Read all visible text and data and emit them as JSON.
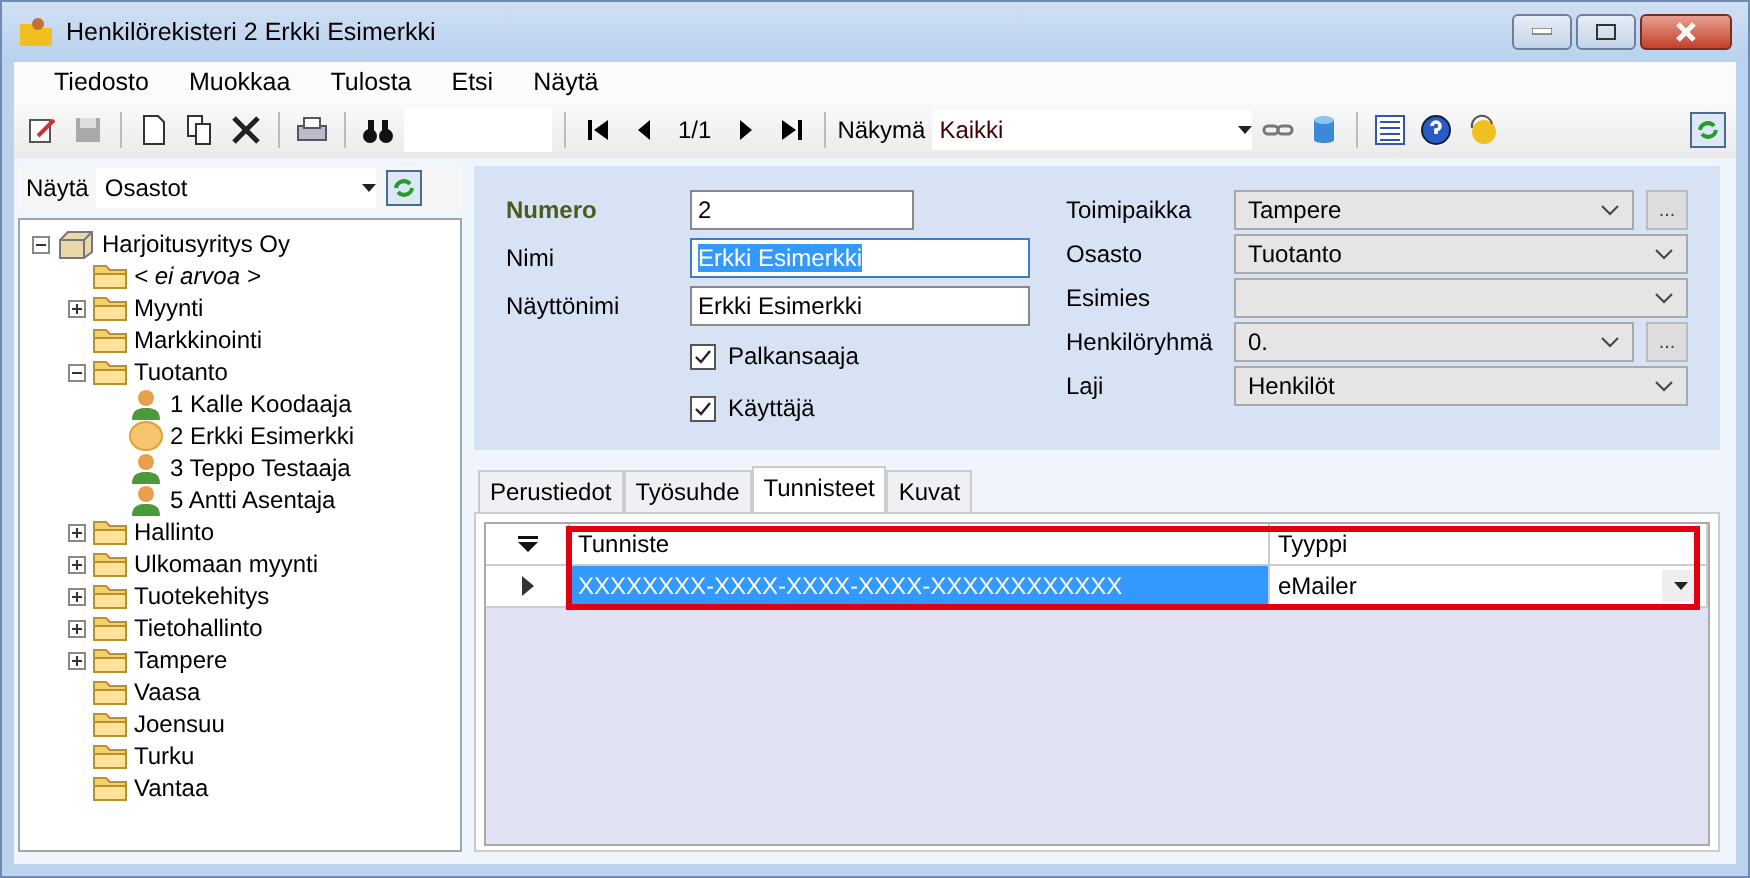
{
  "window": {
    "title": "Henkilörekisteri 2 Erkki Esimerkki"
  },
  "menu": [
    "Tiedosto",
    "Muokkaa",
    "Tulosta",
    "Etsi",
    "Näytä"
  ],
  "toolbar": {
    "position": "1/1",
    "view_label": "Näkymä",
    "view_value": "Kaikki"
  },
  "sidebar": {
    "filter_label": "Näytä",
    "filter_value": "Osastot",
    "tree": [
      {
        "label": "Harjoitusyritys Oy",
        "kind": "company",
        "expanded": true,
        "children": [
          {
            "label": "< ei arvoa >",
            "kind": "empty"
          },
          {
            "label": "Myynti",
            "kind": "folder",
            "expanded": false
          },
          {
            "label": "Markkinointi",
            "kind": "folder"
          },
          {
            "label": "Tuotanto",
            "kind": "folder",
            "expanded": true,
            "children": [
              {
                "label": "1 Kalle Koodaaja",
                "kind": "person"
              },
              {
                "label": "2 Erkki Esimerkki",
                "kind": "current-person"
              },
              {
                "label": "3 Teppo Testaaja",
                "kind": "person"
              },
              {
                "label": "5 Antti Asentaja",
                "kind": "person"
              }
            ]
          },
          {
            "label": "Hallinto",
            "kind": "folder",
            "expanded": false
          },
          {
            "label": "Ulkomaan myynti",
            "kind": "folder",
            "expanded": false
          },
          {
            "label": "Tuotekehitys",
            "kind": "folder",
            "expanded": false
          },
          {
            "label": "Tietohallinto",
            "kind": "folder",
            "expanded": false
          },
          {
            "label": "Tampere",
            "kind": "folder",
            "expanded": false
          },
          {
            "label": "Vaasa",
            "kind": "folder"
          },
          {
            "label": "Joensuu",
            "kind": "folder"
          },
          {
            "label": "Turku",
            "kind": "folder"
          },
          {
            "label": "Vantaa",
            "kind": "folder"
          }
        ]
      }
    ]
  },
  "form": {
    "fields": [
      {
        "label": "Numero",
        "value": "2",
        "bold": true,
        "selected": false,
        "wide": false
      },
      {
        "label": "Nimi",
        "value": "Erkki Esimerkki",
        "bold": false,
        "selected": true,
        "wide": true
      },
      {
        "label": "Näyttönimi",
        "value": "Erkki Esimerkki",
        "bold": false,
        "selected": false,
        "wide": true
      }
    ],
    "checkboxes": [
      {
        "label": "Palkansaaja",
        "checked": true
      },
      {
        "label": "Käyttäjä",
        "checked": true
      }
    ],
    "combos": [
      {
        "label": "Toimipaikka",
        "value": "Tampere",
        "browse_label": "..."
      },
      {
        "label": "Osasto",
        "value": "Tuotanto"
      },
      {
        "label": "Esimies"
      },
      {
        "label": "Henkilöryhmä",
        "value": "0.",
        "browse_label": "..."
      },
      {
        "label": "Laji",
        "value": "Henkilöt"
      }
    ]
  },
  "tabs": [
    {
      "label": "Perustiedot",
      "selected": false
    },
    {
      "label": "Työsuhde",
      "selected": false
    },
    {
      "label": "Tunnisteet",
      "selected": true
    },
    {
      "label": "Kuvat",
      "selected": false
    }
  ],
  "grid": {
    "highlighted": true,
    "columns": [
      "Tunniste",
      "Tyyppi"
    ],
    "rows": [
      {
        "current": true,
        "cells": [
          {
            "value": "XXXXXXXX-XXXX-XXXX-XXXX-XXXXXXXXXXXX",
            "selected": true
          },
          {
            "value": "eMailer",
            "selected": false
          }
        ]
      }
    ]
  }
}
